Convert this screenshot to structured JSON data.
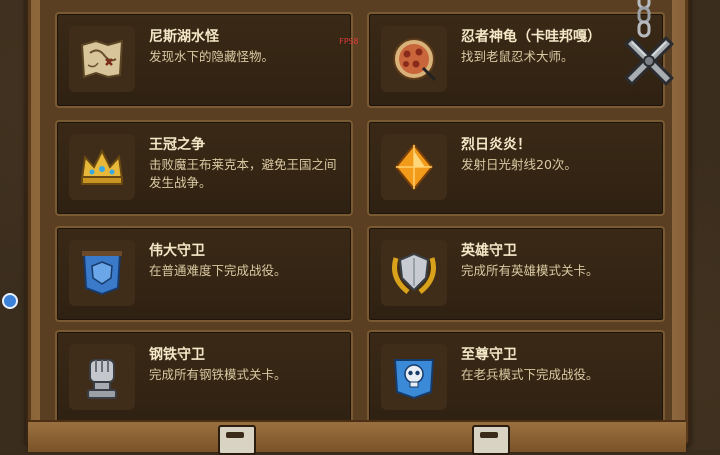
{
  "achievements": [
    {
      "title": "尼斯湖水怪",
      "desc": "发现水下的隐藏怪物。",
      "icon": "treasure-map-icon"
    },
    {
      "title": "忍者神龟（卡哇邦嘎）",
      "desc": "找到老鼠忍术大师。",
      "icon": "pizza-icon"
    },
    {
      "title": "王冠之争",
      "desc": "击败魔王布莱克本，避免王国之间发生战争。",
      "icon": "crown-icon"
    },
    {
      "title": "烈日炎炎！",
      "desc": "发射日光射线20次。",
      "icon": "sun-gem-icon"
    },
    {
      "title": "伟大守卫",
      "desc": "在普通难度下完成战役。",
      "icon": "blue-banner-icon"
    },
    {
      "title": "英雄守卫",
      "desc": "完成所有英雄模式关卡。",
      "icon": "laurel-shield-icon"
    },
    {
      "title": "钢铁守卫",
      "desc": "完成所有钢铁模式关卡。",
      "icon": "iron-fist-icon"
    },
    {
      "title": "至尊守卫",
      "desc": "在老兵模式下完成战役。",
      "icon": "skull-banner-icon"
    }
  ],
  "overlay": {
    "fps_label": "FPS8"
  },
  "colors": {
    "title": "#f3e8c8",
    "desc": "#d9c9a2",
    "card_bg": "#2f2112",
    "frame": "#93693b"
  }
}
